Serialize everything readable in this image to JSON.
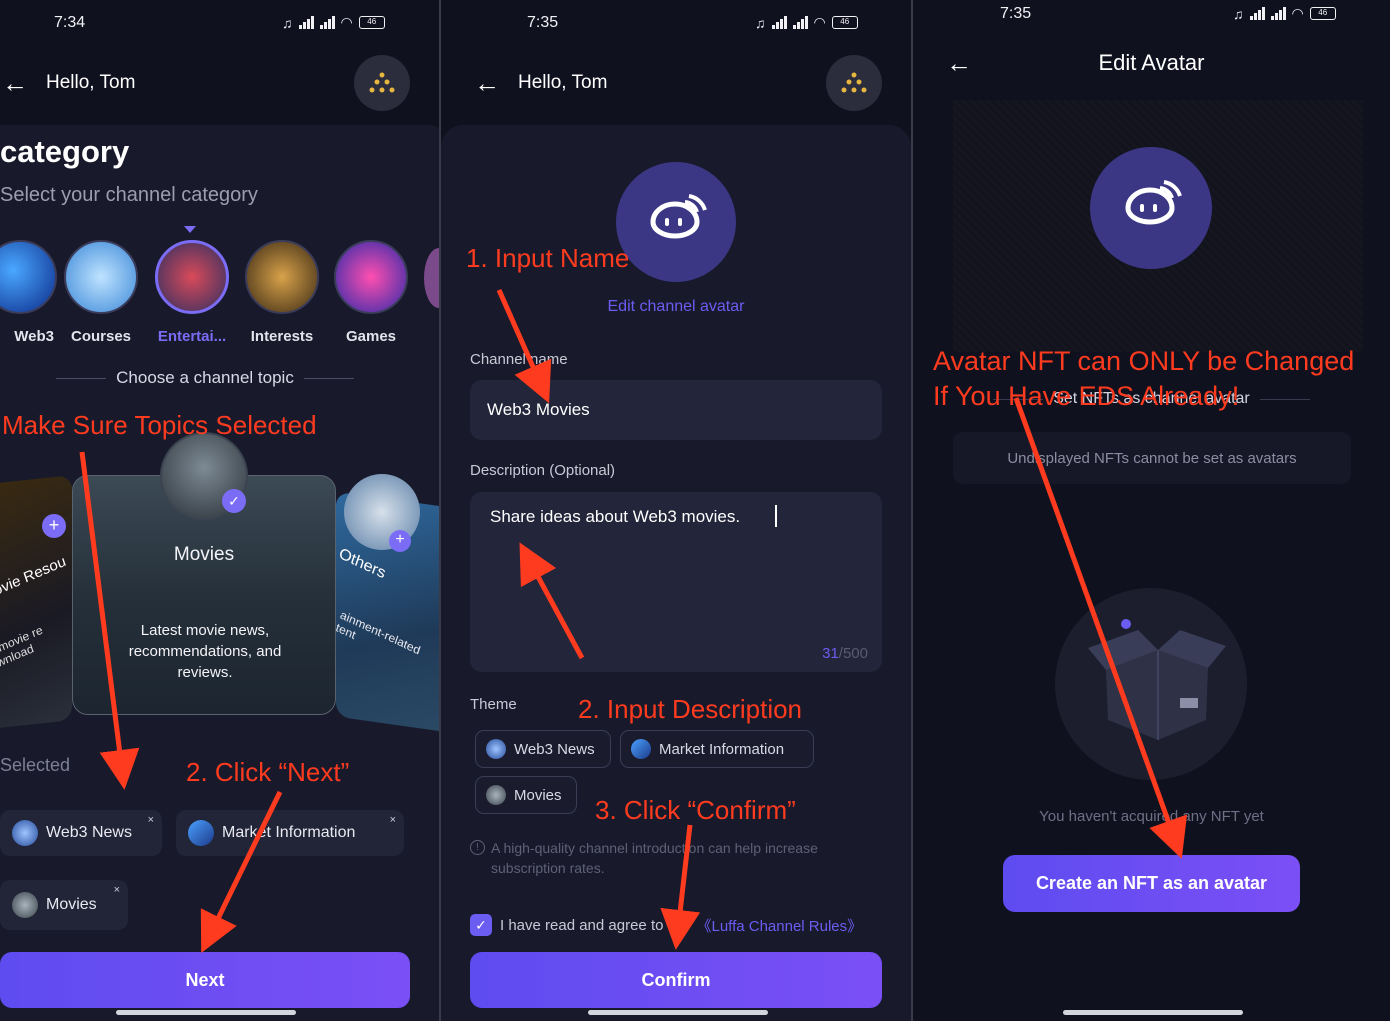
{
  "panel1": {
    "status_time": "7:34",
    "battery": "46",
    "header_title": "Hello, Tom",
    "page_title": "category",
    "page_subtitle": "Select your channel category",
    "categories": [
      {
        "label": "Web3"
      },
      {
        "label": "Courses"
      },
      {
        "label": "Entertai..."
      },
      {
        "label": "Interests"
      },
      {
        "label": "Games"
      }
    ],
    "topic_header": "Choose a channel topic",
    "topic_cards": {
      "left_title": "Movie Resou",
      "left_desc": "ing movie re download",
      "center_title": "Movies",
      "center_desc": "Latest movie news, recommendations, and reviews.",
      "right_title": "Others",
      "right_desc": "ainment-related tent"
    },
    "selected_label": "Selected",
    "selected_chips": [
      {
        "label": "Web3 News"
      },
      {
        "label": "Market Information"
      },
      {
        "label": "Movies"
      }
    ],
    "chip_close": "×",
    "next_button": "Next",
    "annotation_topics": "Make Sure Topics Selected",
    "annotation_next": "2. Click “Next”"
  },
  "panel2": {
    "status_time": "7:35",
    "battery": "46",
    "header_title": "Hello, Tom",
    "edit_avatar_link": "Edit channel avatar",
    "channel_name_label": "Channel name",
    "channel_name_value": "Web3 Movies",
    "description_label": "Description (Optional)",
    "description_value": "Share ideas about Web3 movies.",
    "char_count": "31",
    "char_max": "/500",
    "theme_label": "Theme",
    "theme_chips": [
      {
        "label": "Web3 News"
      },
      {
        "label": "Market Information"
      },
      {
        "label": "Movies"
      }
    ],
    "hint_text": "A high-quality channel introduction can help increase subscription rates.",
    "agree_text": "I have read and agree to the",
    "rules_link": "《Luffa Channel Rules》",
    "confirm_button": "Confirm",
    "annotation_name": "1. Input Name",
    "annotation_desc": "2. Input Description",
    "annotation_confirm": "3. Click “Confirm”"
  },
  "panel3": {
    "status_time": "7:35",
    "battery": "46",
    "header_title": "Edit Avatar",
    "set_nft_header": "Set NFTs as channel avatar",
    "undisplayed_note": "Undisplayed NFTs cannot be set as avatars",
    "empty_text": "You haven't acquired any NFT yet",
    "create_button": "Create an NFT as an avatar",
    "annotation_line1": "Avatar NFT can ONLY be Changed",
    "annotation_line2": "If You Have EDS Already!"
  },
  "colors": {
    "background": "#10111e",
    "accent": "#6a4ff3",
    "accent_text": "#7b6cf6",
    "annotation": "#ff3b1f"
  }
}
